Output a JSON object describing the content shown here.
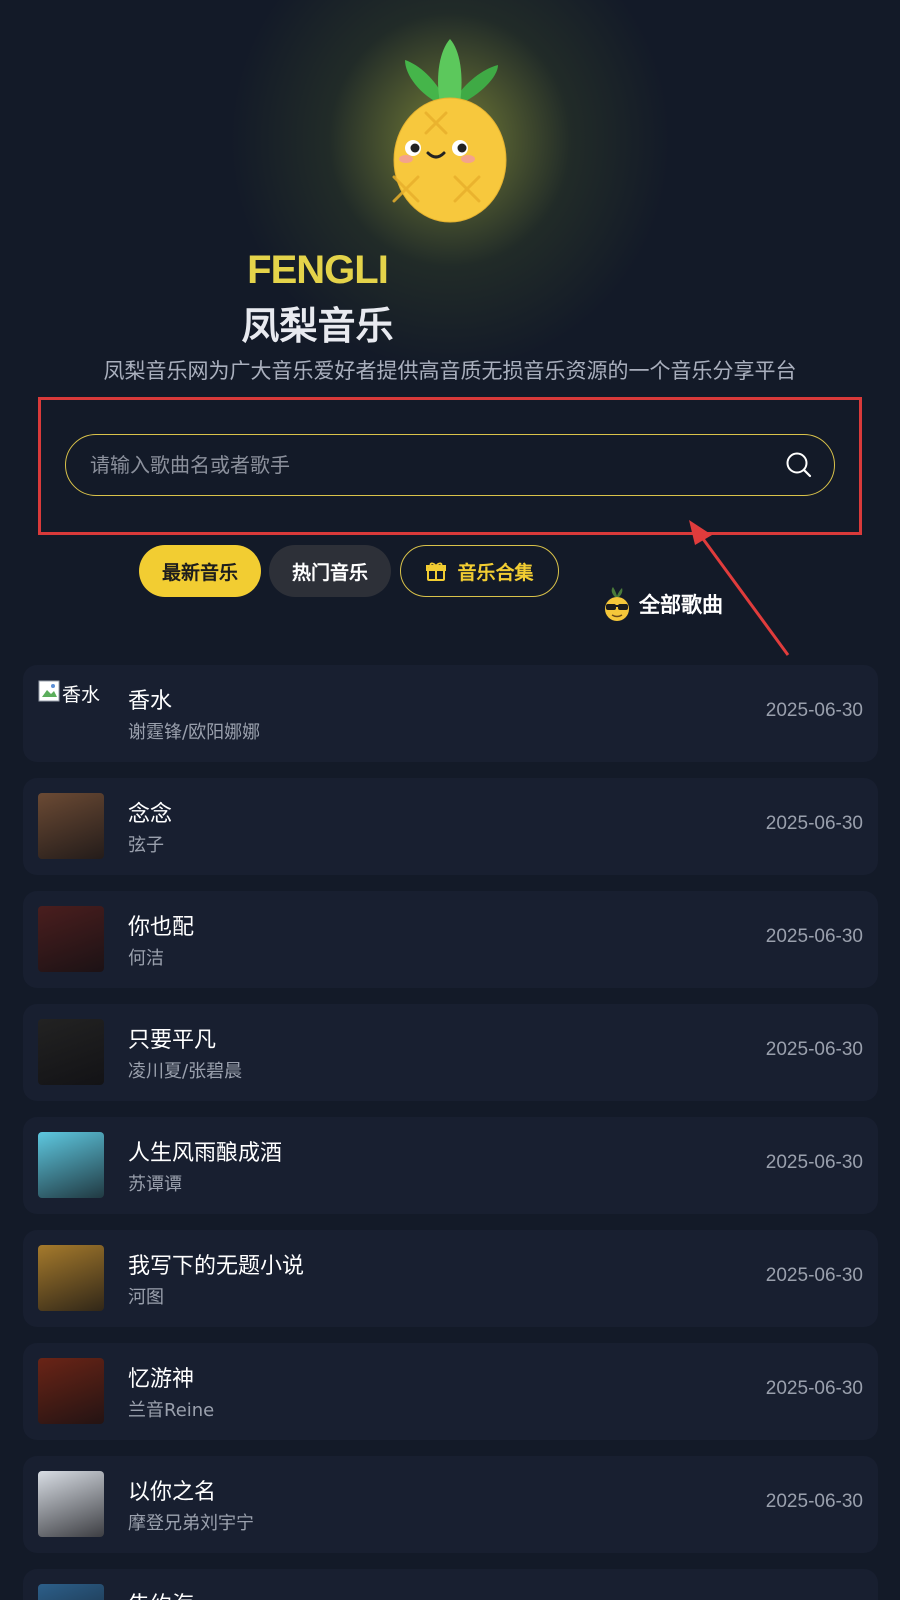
{
  "header": {
    "brand_en": "FENGLI",
    "brand_cn": "凤梨音乐",
    "tagline": "凤梨音乐网为广大音乐爱好者提供高音质无损音乐资源的一个音乐分享平台",
    "mascot_icon": "pineapple-mascot-icon"
  },
  "search": {
    "placeholder": "请输入歌曲名或者歌手",
    "value": "",
    "icon": "search-icon"
  },
  "tabs": [
    {
      "label": "最新音乐",
      "active": true
    },
    {
      "label": "热门音乐",
      "active": false
    },
    {
      "label": "音乐合集",
      "icon": "gift-icon",
      "active": false
    }
  ],
  "all_songs_label": "全部歌曲",
  "all_songs_icon": "cool-pineapple-icon",
  "songs": [
    {
      "title": "香水",
      "artist": "谢霆锋/欧阳娜娜",
      "date": "2025-06-30",
      "cover_alt": "香水",
      "cover_broken": true
    },
    {
      "title": "念念",
      "artist": "弦子",
      "date": "2025-06-30",
      "cover_color": "#6b4a34"
    },
    {
      "title": "你也配",
      "artist": "何洁",
      "date": "2025-06-30",
      "cover_color": "#4a1e1e"
    },
    {
      "title": "只要平凡",
      "artist": "凌川夏/张碧晨",
      "date": "2025-06-30",
      "cover_color": "#222222"
    },
    {
      "title": "人生风雨酿成酒",
      "artist": "苏谭谭",
      "date": "2025-06-30",
      "cover_color": "#5ec8e0"
    },
    {
      "title": "我写下的无题小说",
      "artist": "河图",
      "date": "2025-06-30",
      "cover_color": "#a57a2c"
    },
    {
      "title": "忆游神",
      "artist": "兰音Reine",
      "date": "2025-06-30",
      "cover_color": "#6a2416"
    },
    {
      "title": "以你之名",
      "artist": "摩登兄弟刘宇宁",
      "date": "2025-06-30",
      "cover_color": "#d8dde4"
    },
    {
      "title": "告约海",
      "artist": "",
      "date": "",
      "cover_color": "#2c5f8a"
    }
  ],
  "colors": {
    "accent": "#f2cd32",
    "background": "#131a28",
    "card": "#181f30",
    "highlight_box": "#d93a3a"
  }
}
